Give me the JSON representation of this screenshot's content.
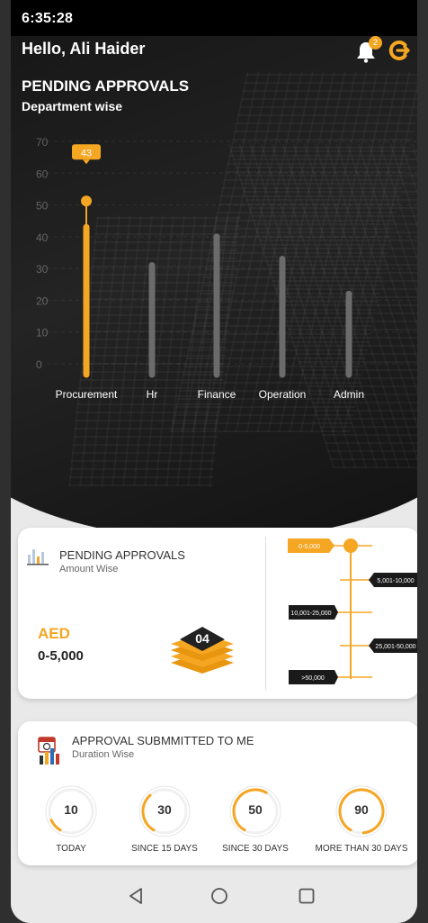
{
  "status": {
    "time": "6:35:28"
  },
  "header": {
    "greeting": "Hello, Ali Haider",
    "notification_count": "2"
  },
  "pending": {
    "title": "PENDING APPROVALS",
    "subtitle": "Department wise"
  },
  "chart_data": {
    "type": "bar",
    "categories": [
      "Procurement",
      "Hr",
      "Finance",
      "Operation",
      "Admin"
    ],
    "values": [
      43,
      31,
      40,
      33,
      22
    ],
    "highlight_index": 0,
    "highlight_label": "43",
    "ylim": [
      0,
      70
    ],
    "yticks": [
      "0",
      "10",
      "20",
      "30",
      "40",
      "50",
      "60",
      "70"
    ],
    "grid": true,
    "colors": {
      "highlight": "#f5a623",
      "bar": "#6b6b6b"
    }
  },
  "amount_card": {
    "title": "PENDING APPROVALS",
    "subtitle": "Amount Wise",
    "currency": "AED",
    "range": "0-5,000",
    "count": "04",
    "timeline": [
      "0-5,000",
      "5,001-10,000",
      "10,001-25,000",
      "25,001-50,000",
      ">50,000"
    ],
    "selected_index": 0
  },
  "duration_card": {
    "title": "APPROVAL SUBMMITTED TO ME",
    "subtitle": "Duration Wise",
    "items": [
      {
        "value": "10",
        "label": "TODAY",
        "fraction": 0.1
      },
      {
        "value": "30",
        "label": "SINCE 15 DAYS",
        "fraction": 0.3
      },
      {
        "value": "50",
        "label": "SINCE 30 DAYS",
        "fraction": 0.5
      },
      {
        "value": "90",
        "label": "MORE THAN 30 DAYS",
        "fraction": 0.9
      }
    ]
  },
  "colors": {
    "accent": "#f5a623",
    "dark": "#1a1a1a"
  }
}
